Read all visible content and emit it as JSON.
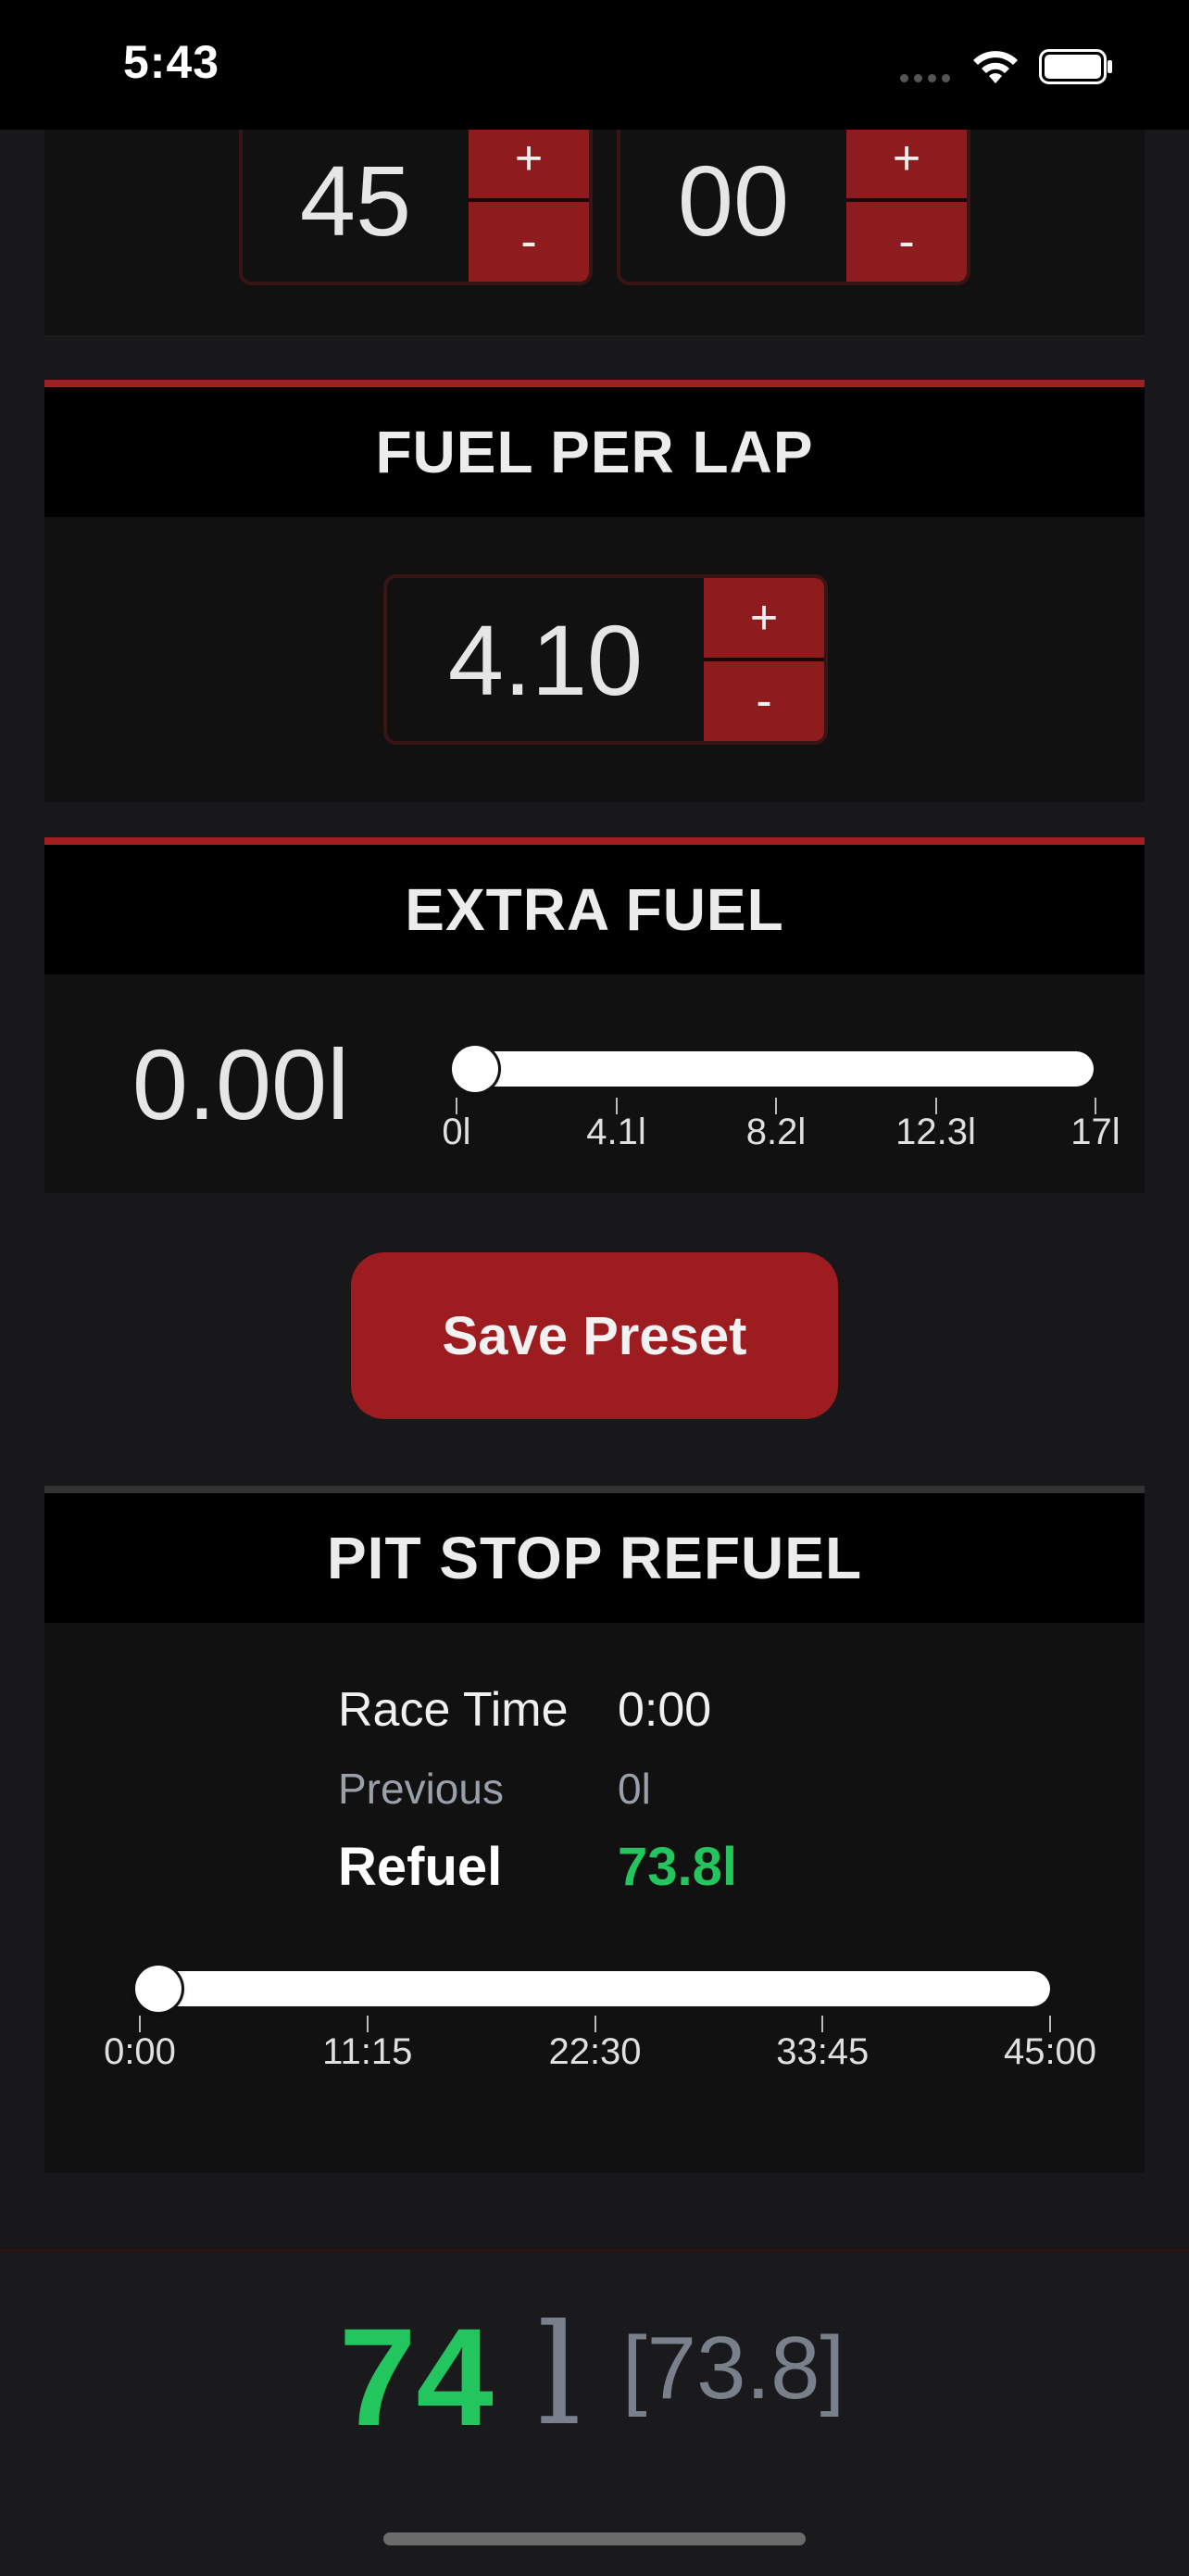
{
  "status_bar": {
    "time": "5:43"
  },
  "race_length": {
    "minutes": {
      "value": "45",
      "plus": "+",
      "minus": "-"
    },
    "seconds": {
      "value": "00",
      "plus": "+",
      "minus": "-"
    }
  },
  "fuel_per_lap": {
    "title": "FUEL PER LAP",
    "value": "4.10",
    "plus": "+",
    "minus": "-"
  },
  "extra_fuel": {
    "title": "EXTRA FUEL",
    "value": "0.00l",
    "slider_value": 0,
    "ticks": [
      "0l",
      "4.1l",
      "8.2l",
      "12.3l",
      "17l"
    ]
  },
  "save_button": "Save Preset",
  "pit_stop": {
    "title": "PIT STOP REFUEL",
    "race_time_label": "Race Time",
    "race_time_value": "0:00",
    "previous_label": "Previous",
    "previous_value": "0l",
    "refuel_label": "Refuel",
    "refuel_value": "73.8l",
    "slider_value": 0,
    "ticks": [
      "0:00",
      "11:15",
      "22:30",
      "33:45",
      "45:00"
    ]
  },
  "total": {
    "value": "74",
    "unit": "l",
    "exact": "[73.8]"
  },
  "colors": {
    "accent_red": "#9d1c1f",
    "refuel_green": "#22c55e"
  }
}
